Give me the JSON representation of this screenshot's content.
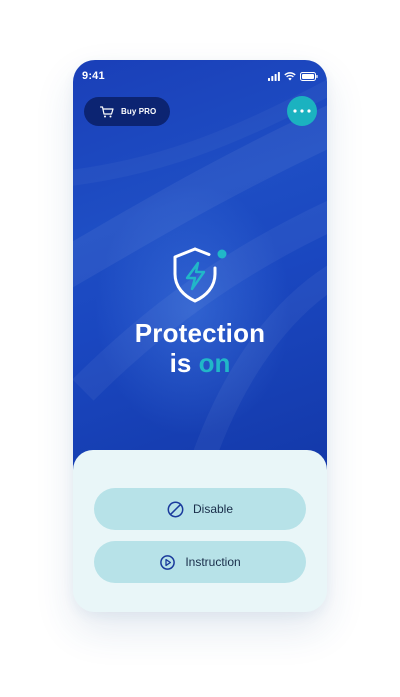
{
  "status_bar": {
    "time": "9:41"
  },
  "header": {
    "buy_pro_label": "Buy PRO",
    "buy_pro_icon": "cart-icon",
    "more_icon": "more-dots-icon"
  },
  "hero": {
    "status_icon": "shield-lightning-icon",
    "title": "Protection",
    "subtitle_prefix": "is",
    "subtitle_status": "on"
  },
  "actions": {
    "disable_label": "Disable",
    "disable_icon": "block-icon",
    "instruction_label": "Instruction",
    "instruction_icon": "play-circle-icon"
  },
  "colors": {
    "hero_blue": "#1a47c0",
    "accent_teal": "#1bb2c0",
    "status_on": "#21b7c8",
    "button_dark": "#0c2472",
    "action_button": "#b7e2e8",
    "sheet_bg": "#e9f6f8"
  }
}
